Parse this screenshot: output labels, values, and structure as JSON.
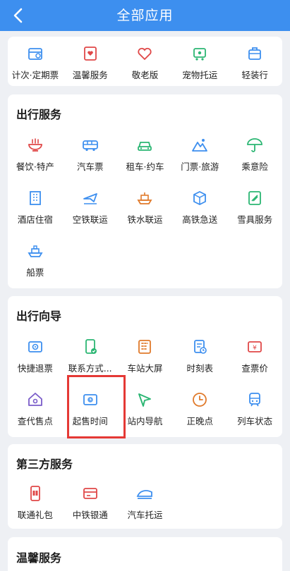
{
  "header": {
    "title": "全部应用"
  },
  "top": [
    {
      "label": "计次·定期票",
      "icon": "ticket-calendar-icon",
      "color": "#3d8fef"
    },
    {
      "label": "温馨服务",
      "icon": "heart-card-icon",
      "color": "#e04848"
    },
    {
      "label": "敬老版",
      "icon": "heart-icon",
      "color": "#e04848"
    },
    {
      "label": "宠物托运",
      "icon": "pet-cart-icon",
      "color": "#2bb673"
    },
    {
      "label": "轻装行",
      "icon": "luggage-icon",
      "color": "#3d8fef"
    }
  ],
  "travel_services": {
    "title": "出行服务",
    "items": [
      {
        "label": "餐饮·特产",
        "icon": "food-bowl-icon",
        "color": "#e04848"
      },
      {
        "label": "汽车票",
        "icon": "bus-icon",
        "color": "#3d8fef"
      },
      {
        "label": "租车·约车",
        "icon": "car-icon",
        "color": "#2bb673"
      },
      {
        "label": "门票·旅游",
        "icon": "mountain-icon",
        "color": "#3d8fef"
      },
      {
        "label": "乘意险",
        "icon": "umbrella-icon",
        "color": "#2bb673"
      },
      {
        "label": "酒店住宿",
        "icon": "hotel-icon",
        "color": "#3d8fef"
      },
      {
        "label": "空铁联运",
        "icon": "plane-icon",
        "color": "#3d8fef"
      },
      {
        "label": "铁水联运",
        "icon": "ship-icon",
        "color": "#e07a2b"
      },
      {
        "label": "高铁急送",
        "icon": "express-box-icon",
        "color": "#3d8fef"
      },
      {
        "label": "雪具服务",
        "icon": "ski-icon",
        "color": "#2bb673"
      },
      {
        "label": "船票",
        "icon": "boat-icon",
        "color": "#3d8fef"
      }
    ]
  },
  "travel_guide": {
    "title": "出行向导",
    "items": [
      {
        "label": "快捷退票",
        "icon": "refund-icon",
        "color": "#3d8fef"
      },
      {
        "label": "联系方式...",
        "icon": "phone-check-icon",
        "color": "#2bb673"
      },
      {
        "label": "车站大屏",
        "icon": "station-board-icon",
        "color": "#e07a2b"
      },
      {
        "label": "时刻表",
        "icon": "timetable-icon",
        "color": "#3d8fef"
      },
      {
        "label": "查票价",
        "icon": "price-tag-icon",
        "color": "#e04848"
      },
      {
        "label": "查代售点",
        "icon": "house-icon",
        "color": "#7a5cc9"
      },
      {
        "label": "起售时间",
        "icon": "clock-ticket-icon",
        "color": "#3d8fef"
      },
      {
        "label": "站内导航",
        "icon": "navigation-arrow-icon",
        "color": "#2bb673"
      },
      {
        "label": "正晚点",
        "icon": "clock-icon",
        "color": "#e07a2b"
      },
      {
        "label": "列车状态",
        "icon": "train-icon",
        "color": "#3d8fef"
      }
    ]
  },
  "third_party": {
    "title": "第三方服务",
    "items": [
      {
        "label": "联通礼包",
        "icon": "gift-phone-icon",
        "color": "#e04848"
      },
      {
        "label": "中铁银通",
        "icon": "card-icon",
        "color": "#e04848"
      },
      {
        "label": "汽车托运",
        "icon": "car-shipping-icon",
        "color": "#3d8fef"
      }
    ]
  },
  "warm_services": {
    "title": "温馨服务"
  }
}
